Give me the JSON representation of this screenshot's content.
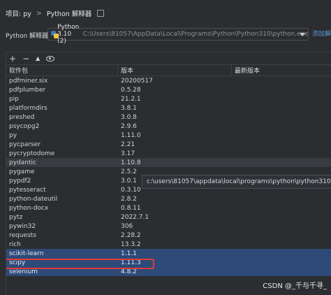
{
  "breadcrumb": {
    "project": "项目: py",
    "separator": ">",
    "page": "Python 解释器"
  },
  "interpreter": {
    "label": "Python 解释器:",
    "name": "Python 3.10 (2)",
    "path": "C:\\Users\\81057\\AppData\\Local\\Programs\\Python\\Python310\\python.exe",
    "add_link": "添加解释器"
  },
  "toolbar": {
    "add": "+",
    "remove": "−",
    "up": "▲"
  },
  "table": {
    "headers": [
      "软件包",
      "版本",
      "最新版本"
    ],
    "rows": [
      {
        "name": "pdfminer.six",
        "version": "20200517",
        "latest": ""
      },
      {
        "name": "pdfplumber",
        "version": "0.5.28",
        "latest": ""
      },
      {
        "name": "pip",
        "version": "21.2.1",
        "latest": ""
      },
      {
        "name": "platformdirs",
        "version": "3.8.1",
        "latest": ""
      },
      {
        "name": "preshed",
        "version": "3.0.8",
        "latest": ""
      },
      {
        "name": "psycopg2",
        "version": "2.9.6",
        "latest": ""
      },
      {
        "name": "py",
        "version": "1.11.0",
        "latest": ""
      },
      {
        "name": "pycparser",
        "version": "2.21",
        "latest": ""
      },
      {
        "name": "pycryptodome",
        "version": "3.17",
        "latest": ""
      },
      {
        "name": "pydantic",
        "version": "1.10.8",
        "latest": ""
      },
      {
        "name": "pygame",
        "version": "2.5.2",
        "latest": ""
      },
      {
        "name": "pypdf2",
        "version": "3.0.1",
        "latest": ""
      },
      {
        "name": "pytesseract",
        "version": "0.3.10",
        "latest": ""
      },
      {
        "name": "python-dateutil",
        "version": "2.8.2",
        "latest": ""
      },
      {
        "name": "python-docx",
        "version": "0.8.11",
        "latest": ""
      },
      {
        "name": "pytz",
        "version": "2022.7.1",
        "latest": ""
      },
      {
        "name": "pywin32",
        "version": "306",
        "latest": ""
      },
      {
        "name": "requests",
        "version": "2.28.2",
        "latest": ""
      },
      {
        "name": "rich",
        "version": "13.3.2",
        "latest": ""
      },
      {
        "name": "scikit-learn",
        "version": "1.1.1",
        "latest": ""
      },
      {
        "name": "scipy",
        "version": "1.11.3",
        "latest": ""
      },
      {
        "name": "selenium",
        "version": "4.8.2",
        "latest": ""
      }
    ]
  },
  "tooltip": "c:\\users\\81057\\appdata\\local\\programs\\python\\python310\\lib\\site-packages",
  "watermark": "CSDN @_千与千寻_",
  "colors": {
    "selection": "#2d4a78",
    "highlight": "#e03b3b",
    "link": "#5b9bd5"
  }
}
